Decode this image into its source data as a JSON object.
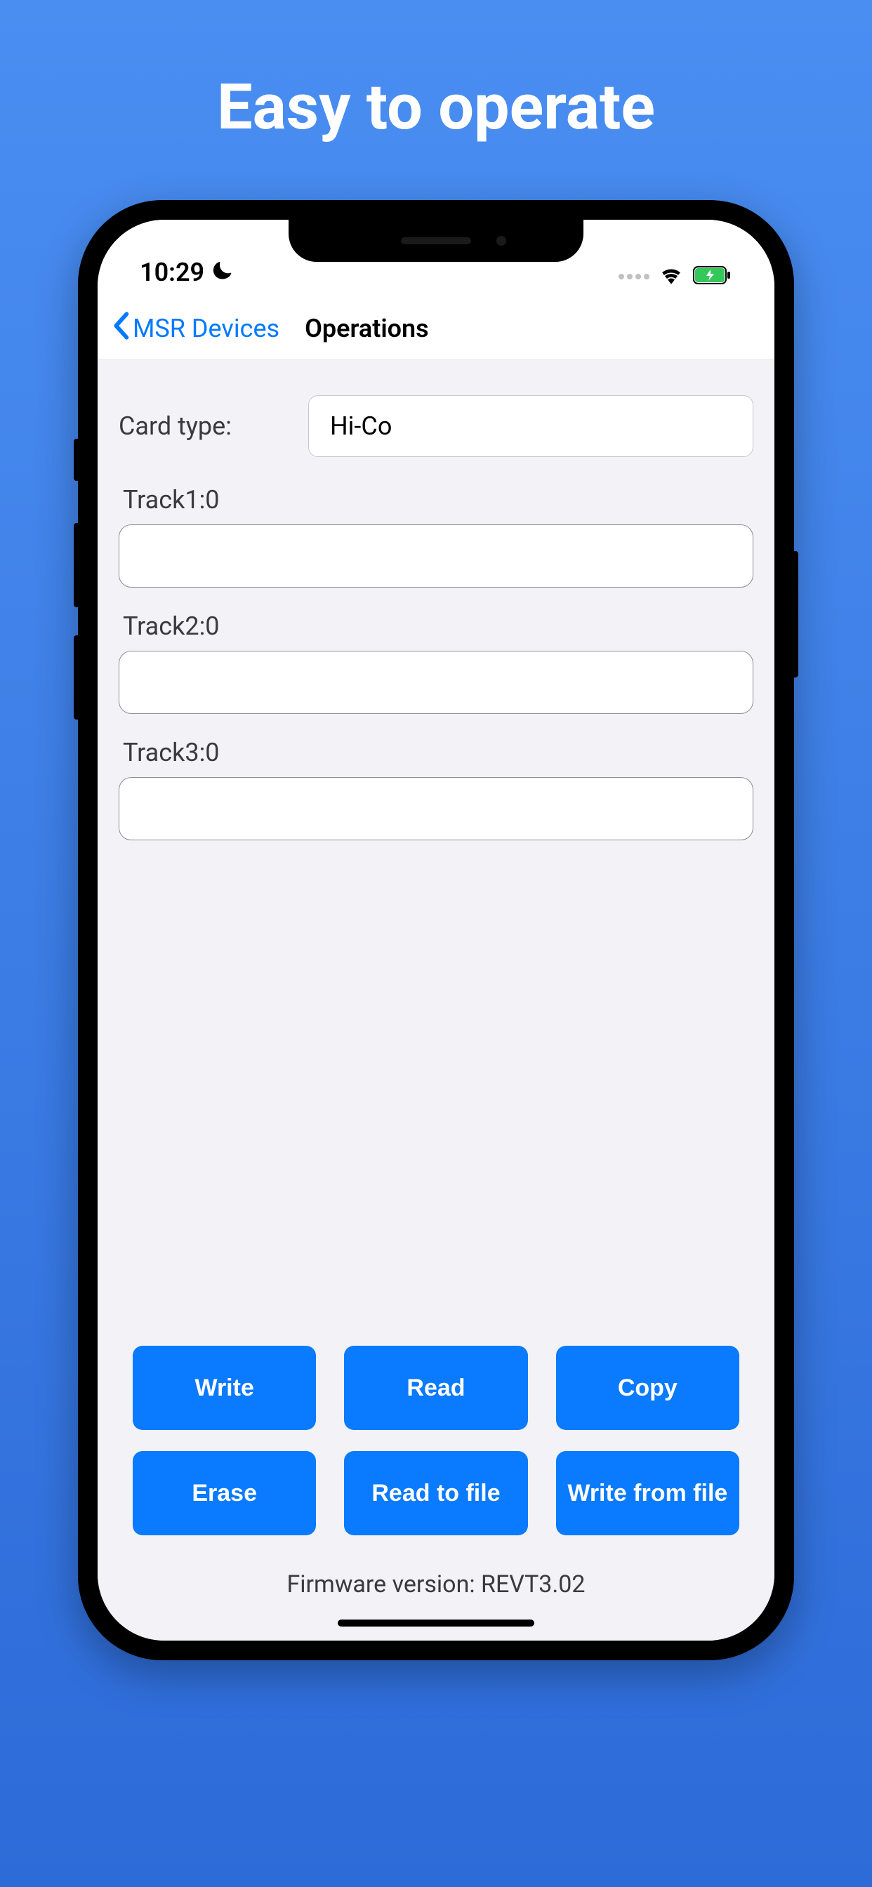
{
  "headline": "Easy to operate",
  "status": {
    "time": "10:29"
  },
  "nav": {
    "back_label": "MSR Devices",
    "title": "Operations"
  },
  "card_type": {
    "label": "Card type:",
    "value": "Hi-Co"
  },
  "tracks": {
    "t1_label": "Track1:0",
    "t1_value": "",
    "t2_label": "Track2:0",
    "t2_value": "",
    "t3_label": "Track3:0",
    "t3_value": ""
  },
  "buttons": {
    "write": "Write",
    "read": "Read",
    "copy": "Copy",
    "erase": "Erase",
    "read_to_file": "Read to file",
    "write_from_file": "Write from file"
  },
  "firmware": "Firmware version: REVT3.02"
}
